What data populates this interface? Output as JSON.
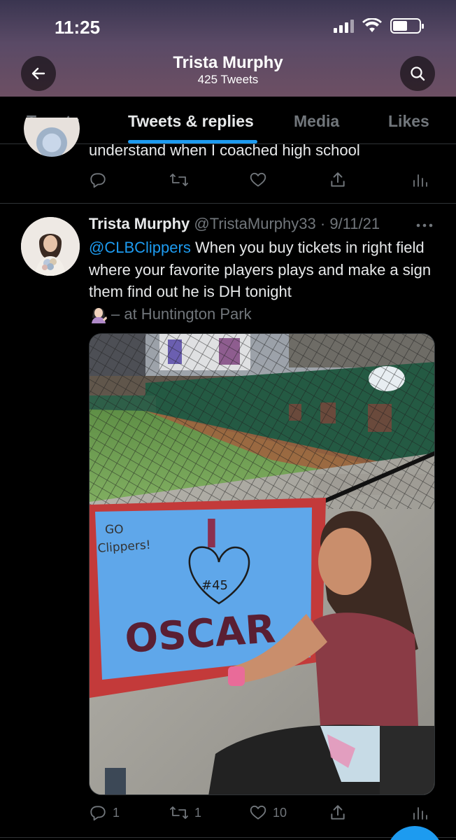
{
  "status_bar": {
    "time": "11:25"
  },
  "header": {
    "name": "Trista Murphy",
    "tweet_count": "425 Tweets"
  },
  "tabs": [
    {
      "label": "Tweets"
    },
    {
      "label": "Tweets & replies"
    },
    {
      "label": "Media"
    },
    {
      "label": "Likes"
    }
  ],
  "previous_tweet": {
    "text": "understand when I coached high school"
  },
  "tweet": {
    "author_name": "Trista Murphy",
    "author_handle": "@TristaMurphy33",
    "separator": "·",
    "date": "9/11/21",
    "mention": "@CLBClippers",
    "text": " When you buy tickets in right field where your favorite players plays and make a sign them find out he is DH tonight",
    "location": "– at Huntington Park",
    "sign": {
      "line1": "GO",
      "line2": "Clippers!",
      "letter": "I",
      "number": "#45",
      "name": "OSCAR"
    },
    "stats": {
      "replies": "1",
      "retweets": "1",
      "likes": "10"
    }
  },
  "colors": {
    "accent": "#1d9bf0",
    "muted": "#71767b",
    "background": "#000000"
  }
}
